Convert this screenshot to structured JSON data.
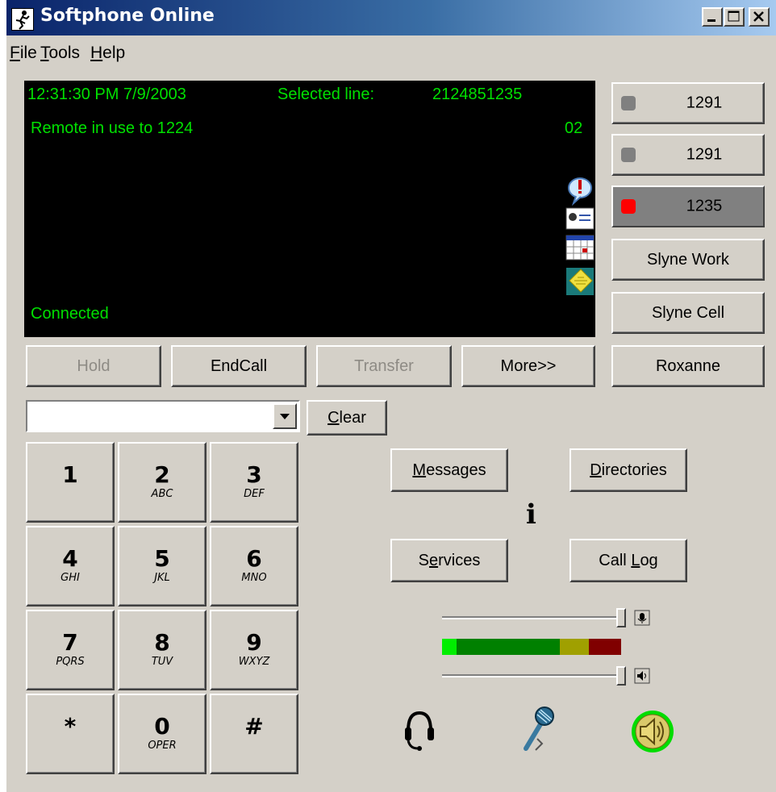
{
  "window": {
    "title": "Softphone Online"
  },
  "menu": [
    {
      "label": "File",
      "mnemonic": "F",
      "rest": "ile"
    },
    {
      "label": "Tools",
      "mnemonic": "T",
      "rest": "ools"
    },
    {
      "label": "Help",
      "mnemonic": "H",
      "rest": "elp"
    }
  ],
  "display": {
    "datetime": "12:31:30 PM 7/9/2003",
    "selected_label": "Selected line:",
    "selected_number": "2124851235",
    "remote_status": "Remote in use to 1224",
    "line_index": "02",
    "connection": "Connected"
  },
  "lines": [
    {
      "label": "1291",
      "lamp": "#808080",
      "active": false
    },
    {
      "label": "1291",
      "lamp": "#808080",
      "active": false
    },
    {
      "label": "1235",
      "lamp": "#ff0000",
      "active": true
    }
  ],
  "speed_dials": [
    {
      "label": "Slyne Work"
    },
    {
      "label": "Slyne Cell"
    },
    {
      "label": "Roxanne"
    }
  ],
  "call_controls": {
    "hold": "Hold",
    "endcall": "EndCall",
    "transfer": "Transfer",
    "more": "More>>"
  },
  "dial": {
    "value": "",
    "clear_mnemonic": "C",
    "clear_rest": "lear"
  },
  "keypad": [
    {
      "digit": "1",
      "letters": ""
    },
    {
      "digit": "2",
      "letters": "ABC"
    },
    {
      "digit": "3",
      "letters": "DEF"
    },
    {
      "digit": "4",
      "letters": "GHI"
    },
    {
      "digit": "5",
      "letters": "JKL"
    },
    {
      "digit": "6",
      "letters": "MNO"
    },
    {
      "digit": "7",
      "letters": "PQRS"
    },
    {
      "digit": "8",
      "letters": "TUV"
    },
    {
      "digit": "9",
      "letters": "WXYZ"
    },
    {
      "digit": "*",
      "letters": ""
    },
    {
      "digit": "0",
      "letters": "OPER"
    },
    {
      "digit": "#",
      "letters": ""
    }
  ],
  "features": {
    "messages": {
      "mnemonic": "M",
      "rest": "essages"
    },
    "directories": {
      "mnemonic": "D",
      "rest": "irectories"
    },
    "services": {
      "pre": "S",
      "mnemonic": "e",
      "rest": "rvices"
    },
    "calllog": {
      "pre": "Call ",
      "mnemonic": "L",
      "rest": "og"
    },
    "info_glyph": "i"
  },
  "audio": {
    "mic_volume": 1.0,
    "speaker_volume": 1.0,
    "meter_colors": [
      "#00ee00",
      "#008000",
      "#a0a000",
      "#800000"
    ]
  },
  "colors": {
    "display_text": "#00e000",
    "display_bg": "#000000",
    "title_bar": "#0a246a"
  }
}
